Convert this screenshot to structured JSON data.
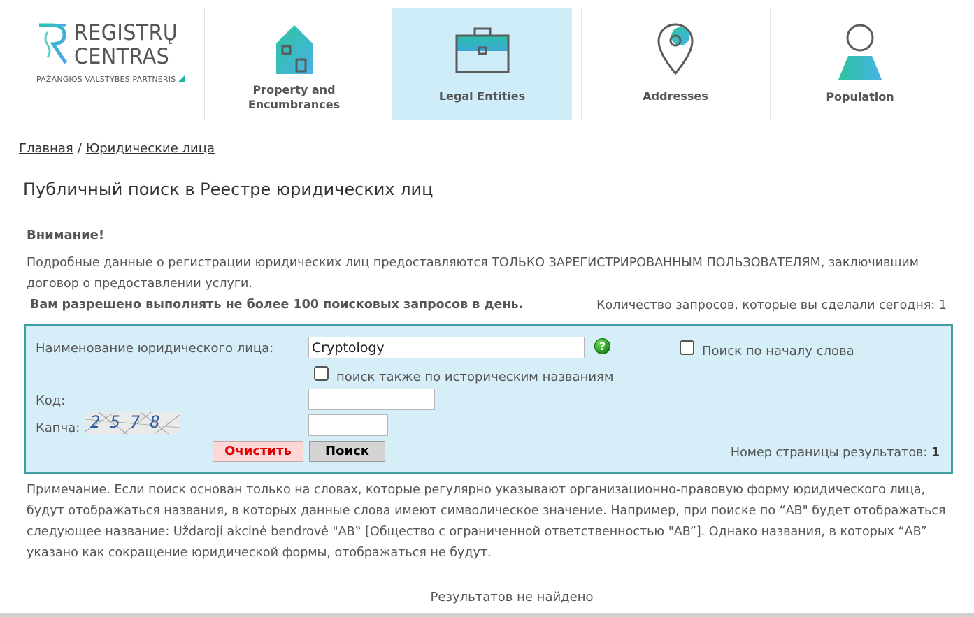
{
  "logo": {
    "line1": "REGISTRŲ",
    "line2": "CENTRAS",
    "tagline": "PAŽANGIOS VALSTYBĖS PARTNERIS"
  },
  "nav": {
    "property": "Property and\nEncumbrances",
    "legal": "Legal Entities",
    "addresses": "Addresses",
    "population": "Population"
  },
  "breadcrumb": {
    "home": "Главная",
    "separator": "/",
    "current": "Юридические лица"
  },
  "page_title": "Публичный поиск в Реестре юридических лиц",
  "notice": {
    "heading": "Внимание!",
    "text": "Подробные данные о регистрации юридических лиц предоставляются ТОЛЬКО ЗАРЕГИСТРИРОВАННЫМ ПОЛЬЗОВАТЕЛЯМ, заключившим договор о предоставлении услуги.",
    "limit": "Вам разрешено выполнять не более 100 поисковых запросов в день.",
    "count_label": "Количество запросов, которые вы сделали сегодня:",
    "count_value": "1"
  },
  "form": {
    "name_label": "Наименование юридического лица:",
    "name_value": "Cryptology",
    "help": "?",
    "word_start_label": "Поиск по началу слова",
    "historical_label": "поиск также по историческим названиям",
    "code_label": "Код:",
    "code_value": "",
    "captcha_label": "Капча:",
    "captcha_text": "2578",
    "captcha_value": "",
    "clear_label": "Очистить",
    "search_label": "Поиск",
    "page_label": "Номер страницы результатов:",
    "page_value": "1"
  },
  "note": "Примечание. Если поиск основан только на словах, которые регулярно указывают организационно-правовую форму юридического лица, будут отображаться названия, в которых данные слова имеют символическое значение. Например, при поиске по “AB\" будет отображаться следующее название: Uždaroji akcinė bendrovė \"AB‟ [Общество с ограниченной ответственностью \"AB”]. Однако названия, в которых “AB” указано как сокращение юридической формы, отображаться не будут.",
  "results": {
    "empty": "Результатов не найдено"
  },
  "colors": {
    "accent_teal": "#3f9fa3",
    "form_bg": "#d6eef8",
    "nav_active_bg": "#cfedf8",
    "clear_red": "#e00000"
  }
}
